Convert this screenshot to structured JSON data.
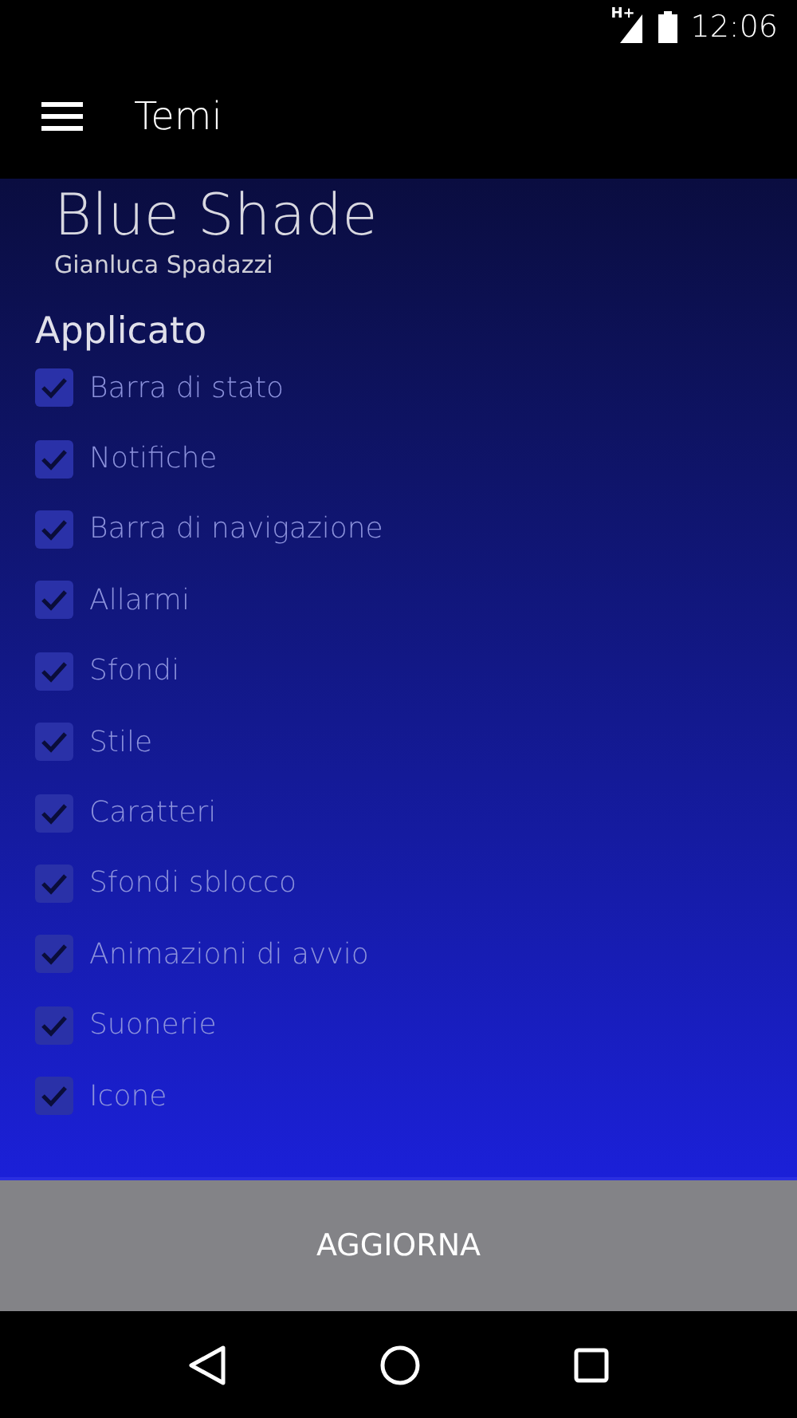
{
  "status_bar": {
    "network": "H+",
    "time": "12:06"
  },
  "toolbar": {
    "title": "Temi"
  },
  "theme": {
    "name": "Blue Shade",
    "author": "Gianluca Spadazzi"
  },
  "section": {
    "title": "Applicato"
  },
  "items": [
    {
      "label": "Barra di stato",
      "checked": true,
      "disabled": true
    },
    {
      "label": "Notifiche",
      "checked": true,
      "disabled": true
    },
    {
      "label": "Barra di navigazione",
      "checked": true,
      "disabled": true
    },
    {
      "label": "Allarmi",
      "checked": true,
      "disabled": true
    },
    {
      "label": "Sfondi",
      "checked": true,
      "disabled": true
    },
    {
      "label": "Stile",
      "checked": true,
      "disabled": true
    },
    {
      "label": "Caratteri",
      "checked": true,
      "disabled": true
    },
    {
      "label": "Sfondi sblocco",
      "checked": true,
      "disabled": true
    },
    {
      "label": "Animazioni di avvio",
      "checked": true,
      "disabled": true
    },
    {
      "label": "Suonerie",
      "checked": true,
      "disabled": true
    },
    {
      "label": "Icone",
      "checked": true,
      "disabled": true
    }
  ],
  "button": {
    "label": "AGGIORNA"
  }
}
